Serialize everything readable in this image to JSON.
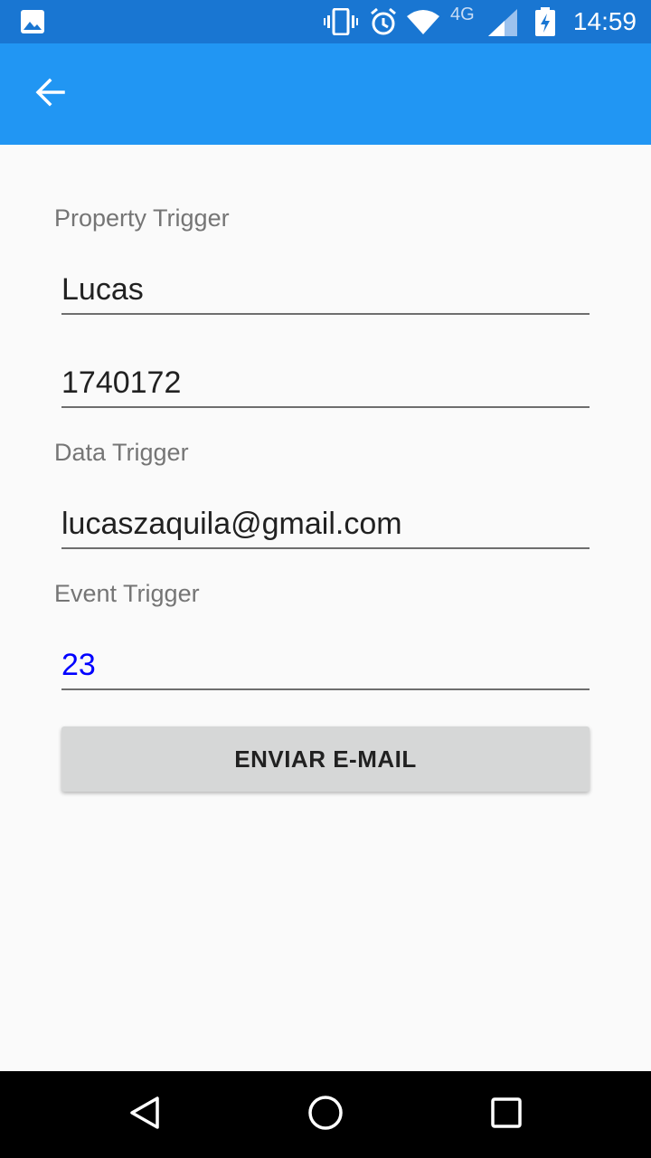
{
  "status_bar": {
    "time": "14:59",
    "network": "4G",
    "icons": [
      "image-notification-icon",
      "vibrate-icon",
      "alarm-icon",
      "wifi-icon",
      "signal-icon",
      "battery-charging-icon"
    ]
  },
  "app_bar": {
    "back_icon": "arrow-back-icon"
  },
  "form": {
    "property_trigger_label": "Property Trigger",
    "name_value": "Lucas",
    "number_value": "1740172",
    "data_trigger_label": "Data Trigger",
    "email_value": "lucaszaquila@gmail.com",
    "event_trigger_label": "Event Trigger",
    "event_value": "23",
    "event_value_color": "#0000ff",
    "send_button_label": "ENVIAR E-MAIL"
  },
  "nav_bar": {
    "icons": [
      "back-triangle-icon",
      "home-circle-icon",
      "recents-square-icon"
    ]
  },
  "colors": {
    "status_bar": "#1976d2",
    "app_bar": "#2196f3",
    "background": "#fafafa",
    "button": "#d6d7d7"
  }
}
